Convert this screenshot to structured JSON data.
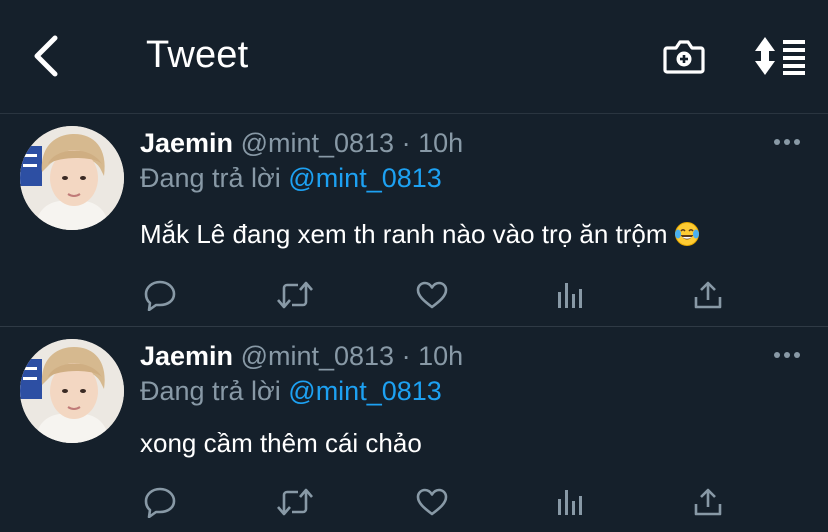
{
  "header": {
    "title": "Tweet",
    "back_icon": "chevron-left-icon",
    "camera_icon": "camera-add-icon",
    "sort_icon": "sort-icon"
  },
  "tweets": [
    {
      "name": "Jaemin",
      "handle": "@mint_0813",
      "dot": "·",
      "time": "10h",
      "reply_prefix": "Đang trả lời",
      "reply_to": "@mint_0813",
      "text": "Mắk Lê đang xem th ranh nào vào trọ ăn trộm",
      "emoji": "face-with-tears-of-joy",
      "icons": [
        "reply-icon",
        "retweet-icon",
        "like-icon",
        "stats-icon",
        "share-icon",
        "more-icon"
      ]
    },
    {
      "name": "Jaemin",
      "handle": "@mint_0813",
      "dot": "·",
      "time": "10h",
      "reply_prefix": "Đang trả lời",
      "reply_to": "@mint_0813",
      "text": "xong cầm thêm cái chảo",
      "icons": [
        "reply-icon",
        "retweet-icon",
        "like-icon",
        "stats-icon",
        "share-icon",
        "more-icon"
      ]
    }
  ],
  "colors": {
    "background": "#15202b",
    "text": "#ffffff",
    "muted": "#8899a6",
    "accent": "#1da1f2",
    "divider": "#2f3a45"
  }
}
